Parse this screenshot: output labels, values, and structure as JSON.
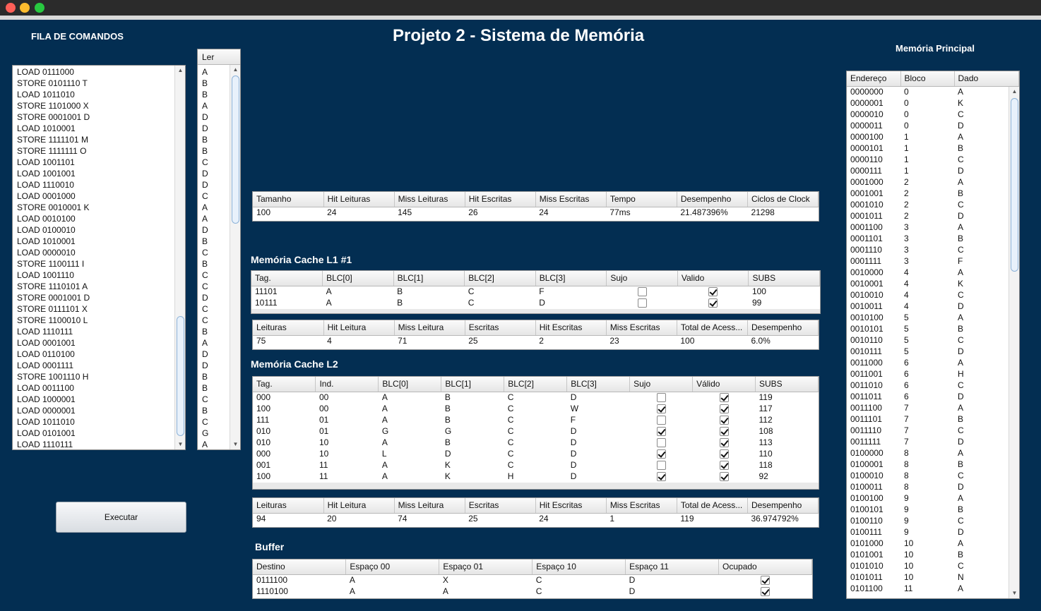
{
  "window": {
    "title": "Projeto 2 - Sistema de Memória"
  },
  "queue": {
    "title": "FILA DE COMANDOS",
    "commands": [
      "LOAD 0111000",
      "STORE 0101110 T",
      "LOAD 1011010",
      "STORE 1101000 X",
      "STORE 0001001 D",
      "LOAD 1010001",
      "STORE 1111101 M",
      "STORE 1111111 O",
      "LOAD 1001101",
      "LOAD 1001001",
      "LOAD 1110010",
      "LOAD 0001000",
      "STORE 0010001 K",
      "LOAD 0010100",
      "LOAD 0100010",
      "LOAD 1010001",
      "LOAD 0000010",
      "STORE 1100111 I",
      "LOAD 1001110",
      "STORE 1110101 A",
      "STORE 0001001 D",
      "STORE 0111101 X",
      "STORE 1100010 L",
      "LOAD 1110111",
      "LOAD 0001001",
      "LOAD 0110100",
      "LOAD 0001111",
      "STORE 1001110 H",
      "LOAD 0011100",
      "LOAD 1000001",
      "LOAD 0000001",
      "LOAD 1011010",
      "LOAD 0101001",
      "LOAD 1110111"
    ],
    "execute_label": "Executar"
  },
  "ler": {
    "header": "Ler",
    "values": [
      "A",
      "B",
      "B",
      "A",
      "D",
      "D",
      "B",
      "B",
      "C",
      "D",
      "D",
      "C",
      "A",
      "A",
      "D",
      "B",
      "C",
      "B",
      "C",
      "C",
      "D",
      "C",
      "C",
      "B",
      "A",
      "D",
      "D",
      "B",
      "B",
      "C",
      "B",
      "C",
      "G",
      "A"
    ]
  },
  "stats": {
    "headers": [
      "Tamanho",
      "Hit Leituras",
      "Miss Leituras",
      "Hit Escritas",
      "Miss Escritas",
      "Tempo",
      "Desempenho",
      "Ciclos de Clock"
    ],
    "values": [
      "100",
      "24",
      "145",
      "26",
      "24",
      "77ms",
      "21.487396%",
      "21298"
    ]
  },
  "l1": {
    "title": "Memória Cache L1 #1",
    "headers": [
      "Tag.",
      "BLC[0]",
      "BLC[1]",
      "BLC[2]",
      "BLC[3]",
      "Sujo",
      "Valido",
      "SUBS"
    ],
    "rows": [
      {
        "tag": "11101",
        "b0": "A",
        "b1": "B",
        "b2": "C",
        "b3": "F",
        "sujo": false,
        "valido": true,
        "subs": "100"
      },
      {
        "tag": "10111",
        "b0": "A",
        "b1": "B",
        "b2": "C",
        "b3": "D",
        "sujo": false,
        "valido": true,
        "subs": "99"
      }
    ],
    "stats_headers": [
      "Leituras",
      "Hit Leitura",
      "Miss Leitura",
      "Escritas",
      "Hit Escritas",
      "Miss Escritas",
      "Total de Acess...",
      "Desempenho"
    ],
    "stats_values": [
      "75",
      "4",
      "71",
      "25",
      "2",
      "23",
      "100",
      "6.0%"
    ]
  },
  "l2": {
    "title": "Memória Cache L2",
    "headers": [
      "Tag.",
      "Ind.",
      "BLC[0]",
      "BLC[1]",
      "BLC[2]",
      "BLC[3]",
      "Sujo",
      "Válido",
      "SUBS"
    ],
    "rows": [
      {
        "tag": "000",
        "ind": "00",
        "b0": "A",
        "b1": "B",
        "b2": "C",
        "b3": "D",
        "sujo": false,
        "valido": true,
        "subs": "119"
      },
      {
        "tag": "100",
        "ind": "00",
        "b0": "A",
        "b1": "B",
        "b2": "C",
        "b3": "W",
        "sujo": true,
        "valido": true,
        "subs": "117"
      },
      {
        "tag": "111",
        "ind": "01",
        "b0": "A",
        "b1": "B",
        "b2": "C",
        "b3": "F",
        "sujo": false,
        "valido": true,
        "subs": "112"
      },
      {
        "tag": "010",
        "ind": "01",
        "b0": "G",
        "b1": "G",
        "b2": "C",
        "b3": "D",
        "sujo": true,
        "valido": true,
        "subs": "108"
      },
      {
        "tag": "010",
        "ind": "10",
        "b0": "A",
        "b1": "B",
        "b2": "C",
        "b3": "D",
        "sujo": false,
        "valido": true,
        "subs": "113"
      },
      {
        "tag": "000",
        "ind": "10",
        "b0": "L",
        "b1": "D",
        "b2": "C",
        "b3": "D",
        "sujo": true,
        "valido": true,
        "subs": "110"
      },
      {
        "tag": "001",
        "ind": "11",
        "b0": "A",
        "b1": "K",
        "b2": "C",
        "b3": "D",
        "sujo": false,
        "valido": true,
        "subs": "118"
      },
      {
        "tag": "100",
        "ind": "11",
        "b0": "A",
        "b1": "K",
        "b2": "H",
        "b3": "D",
        "sujo": true,
        "valido": true,
        "subs": "92"
      }
    ],
    "stats_headers": [
      "Leituras",
      "Hit Leitura",
      "Miss Leitura",
      "Escritas",
      "Hit Escritas",
      "Miss Escritas",
      "Total de Acess...",
      "Desempenho"
    ],
    "stats_values": [
      "94",
      "20",
      "74",
      "25",
      "24",
      "1",
      "119",
      "36.974792%"
    ]
  },
  "buffer": {
    "title": "Buffer",
    "headers": [
      "Destino",
      "Espaço 00",
      "Espaço 01",
      "Espaço 10",
      "Espaço 11",
      "Ocupado"
    ],
    "rows": [
      {
        "destino": "0111100",
        "e00": "A",
        "e01": "X",
        "e10": "C",
        "e11": "D",
        "ocupado": true
      },
      {
        "destino": "1110100",
        "e00": "A",
        "e01": "A",
        "e10": "C",
        "e11": "D",
        "ocupado": true
      }
    ]
  },
  "main_memory": {
    "title": "Memória Principal",
    "headers": [
      "Endereço",
      "Bloco",
      "Dado"
    ],
    "rows": [
      [
        "0000000",
        "0",
        "A"
      ],
      [
        "0000001",
        "0",
        "K"
      ],
      [
        "0000010",
        "0",
        "C"
      ],
      [
        "0000011",
        "0",
        "D"
      ],
      [
        "0000100",
        "1",
        "A"
      ],
      [
        "0000101",
        "1",
        "B"
      ],
      [
        "0000110",
        "1",
        "C"
      ],
      [
        "0000111",
        "1",
        "D"
      ],
      [
        "0001000",
        "2",
        "A"
      ],
      [
        "0001001",
        "2",
        "B"
      ],
      [
        "0001010",
        "2",
        "C"
      ],
      [
        "0001011",
        "2",
        "D"
      ],
      [
        "0001100",
        "3",
        "A"
      ],
      [
        "0001101",
        "3",
        "B"
      ],
      [
        "0001110",
        "3",
        "C"
      ],
      [
        "0001111",
        "3",
        "F"
      ],
      [
        "0010000",
        "4",
        "A"
      ],
      [
        "0010001",
        "4",
        "K"
      ],
      [
        "0010010",
        "4",
        "C"
      ],
      [
        "0010011",
        "4",
        "D"
      ],
      [
        "0010100",
        "5",
        "A"
      ],
      [
        "0010101",
        "5",
        "B"
      ],
      [
        "0010110",
        "5",
        "C"
      ],
      [
        "0010111",
        "5",
        "D"
      ],
      [
        "0011000",
        "6",
        "A"
      ],
      [
        "0011001",
        "6",
        "H"
      ],
      [
        "0011010",
        "6",
        "C"
      ],
      [
        "0011011",
        "6",
        "D"
      ],
      [
        "0011100",
        "7",
        "A"
      ],
      [
        "0011101",
        "7",
        "B"
      ],
      [
        "0011110",
        "7",
        "C"
      ],
      [
        "0011111",
        "7",
        "D"
      ],
      [
        "0100000",
        "8",
        "A"
      ],
      [
        "0100001",
        "8",
        "B"
      ],
      [
        "0100010",
        "8",
        "C"
      ],
      [
        "0100011",
        "8",
        "D"
      ],
      [
        "0100100",
        "9",
        "A"
      ],
      [
        "0100101",
        "9",
        "B"
      ],
      [
        "0100110",
        "9",
        "C"
      ],
      [
        "0100111",
        "9",
        "D"
      ],
      [
        "0101000",
        "10",
        "A"
      ],
      [
        "0101001",
        "10",
        "B"
      ],
      [
        "0101010",
        "10",
        "C"
      ],
      [
        "0101011",
        "10",
        "N"
      ],
      [
        "0101100",
        "11",
        "A"
      ]
    ]
  }
}
